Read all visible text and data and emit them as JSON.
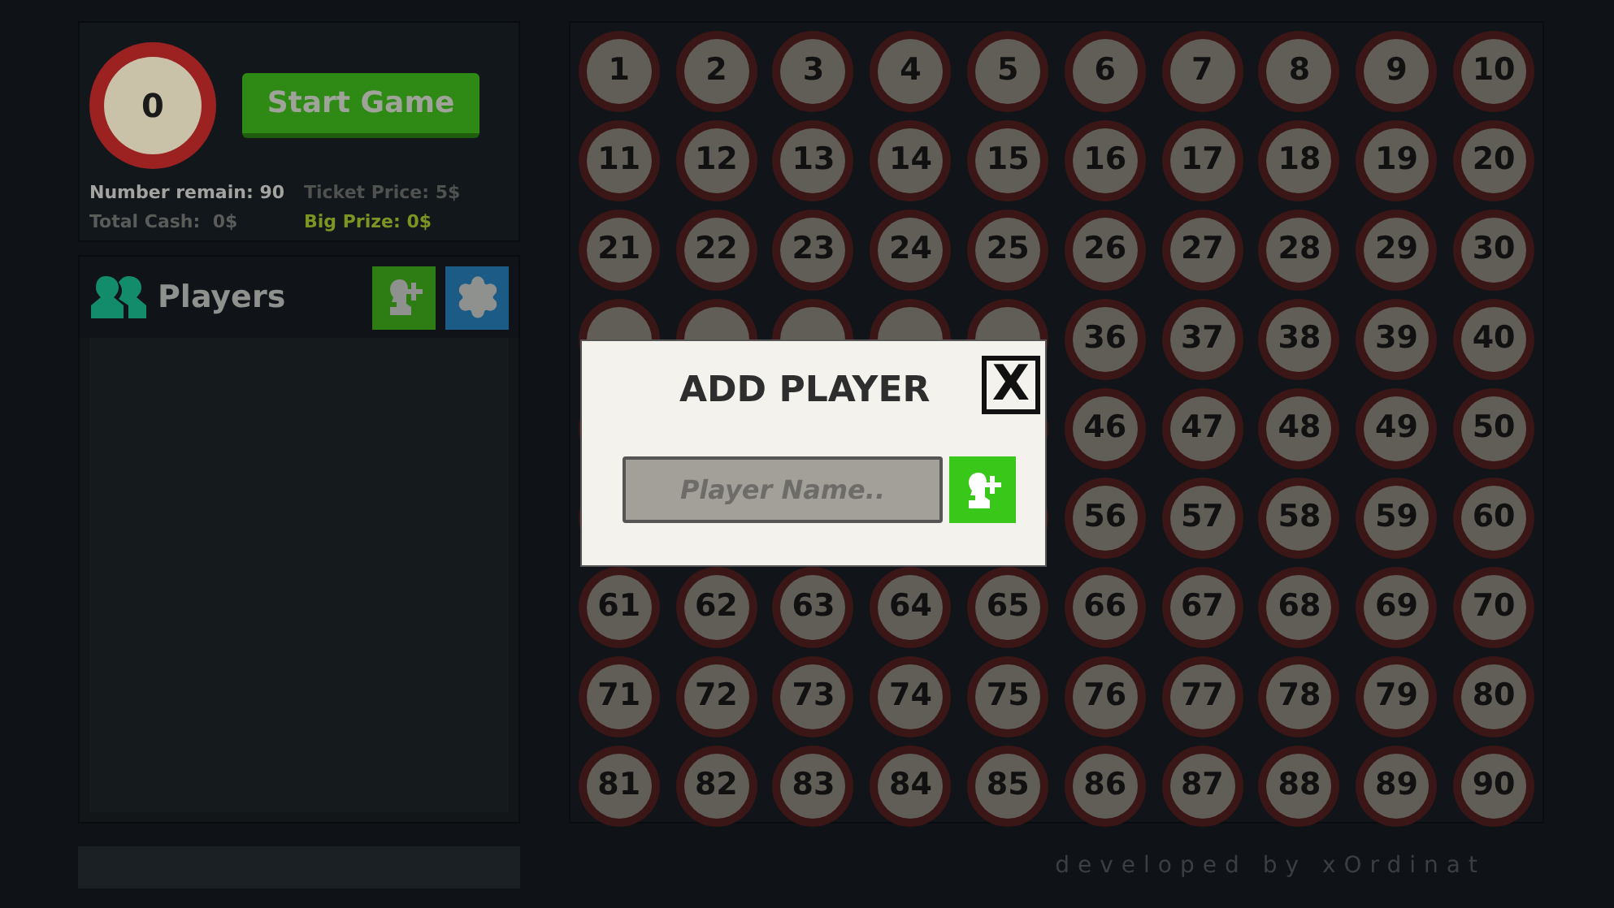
{
  "drawn_ball": {
    "number": "0"
  },
  "start_button": "Start Game",
  "stats": [
    {
      "text": "Number remain: 90",
      "color": "#a3a3a0"
    },
    {
      "text": "Ticket Price: 5$",
      "color": "#505250"
    },
    {
      "text": "Total Cash:  0$",
      "color": "#5a5c5a"
    },
    {
      "text": "Big Prize: 0$",
      "color": "#7d9422"
    }
  ],
  "players_panel": {
    "title": "Players"
  },
  "board": {
    "rows": [
      [
        "1",
        "2",
        "3",
        "4",
        "5",
        "6",
        "7",
        "8",
        "9",
        "10"
      ],
      [
        "11",
        "12",
        "13",
        "14",
        "15",
        "16",
        "17",
        "18",
        "19",
        "20"
      ],
      [
        "21",
        "22",
        "23",
        "24",
        "25",
        "26",
        "27",
        "28",
        "29",
        "30"
      ],
      [
        null,
        null,
        null,
        null,
        null,
        "36",
        "37",
        "38",
        "39",
        "40"
      ],
      [
        null,
        null,
        null,
        null,
        null,
        "46",
        "47",
        "48",
        "49",
        "50"
      ],
      [
        null,
        null,
        null,
        null,
        null,
        "56",
        "57",
        "58",
        "59",
        "60"
      ],
      [
        "61",
        "62",
        "63",
        "64",
        "65",
        "66",
        "67",
        "68",
        "69",
        "70"
      ],
      [
        "71",
        "72",
        "73",
        "74",
        "75",
        "76",
        "77",
        "78",
        "79",
        "80"
      ],
      [
        "81",
        "82",
        "83",
        "84",
        "85",
        "86",
        "87",
        "88",
        "89",
        "90"
      ]
    ]
  },
  "dialog": {
    "title": "ADD PLAYER",
    "close": "X",
    "field": {
      "placeholder": "Player Name.."
    }
  },
  "footer": "developed by xOrdinat"
}
